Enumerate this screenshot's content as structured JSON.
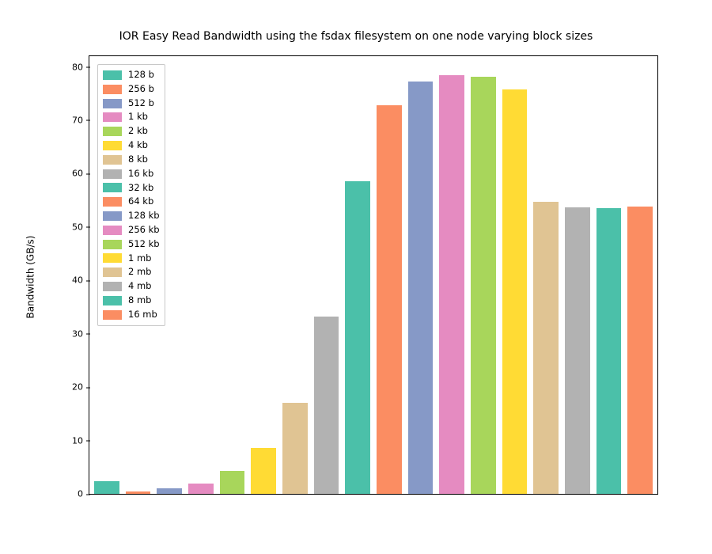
{
  "chart_data": {
    "type": "bar",
    "title": "IOR Easy Read Bandwidth using the fsdax filesystem on one node varying block sizes",
    "xlabel": "",
    "ylabel": "Bandwidth (GB/s)",
    "ylim": [
      0,
      82
    ],
    "yticks": [
      0,
      10,
      20,
      30,
      40,
      50,
      60,
      70,
      80
    ],
    "categories": [
      "128 b",
      "256 b",
      "512 b",
      "1 kb",
      "2 kb",
      "4 kb",
      "8 kb",
      "16 kb",
      "32 kb",
      "64 kb",
      "128 kb",
      "256 kb",
      "512 kb",
      "1 mb",
      "2 mb",
      "4 mb",
      "8 mb",
      "16 mb"
    ],
    "values": [
      2.4,
      0.5,
      1.1,
      2.0,
      4.3,
      8.6,
      17.0,
      33.2,
      58.6,
      72.8,
      77.2,
      78.5,
      78.1,
      75.8,
      54.7,
      53.7,
      53.6,
      53.8
    ],
    "colors": [
      "#4BC0A9",
      "#FB8D62",
      "#8699C7",
      "#E58BC1",
      "#A8D65B",
      "#FFDB34",
      "#E0C493",
      "#B2B2B2",
      "#4BC0A9",
      "#FB8D62",
      "#8699C7",
      "#E58BC1",
      "#A8D65B",
      "#FFDB34",
      "#E0C493",
      "#B2B2B2",
      "#4BC0A9",
      "#FB8D62"
    ],
    "legend_position": "upper-left"
  }
}
